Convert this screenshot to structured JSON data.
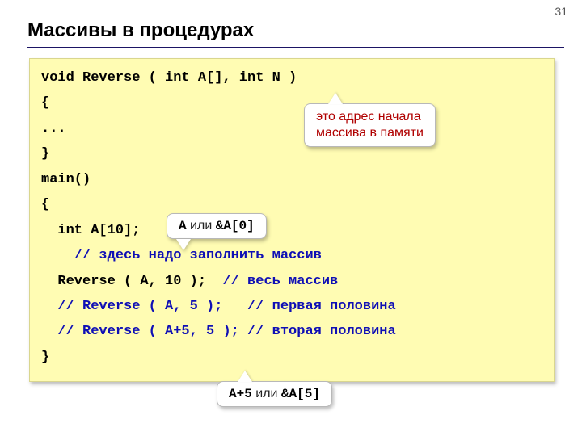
{
  "page_number": "31",
  "title": "Массивы в процедурах",
  "code": {
    "l1": "void Reverse ( int A[], int N )",
    "l2": "{",
    "l3": "...",
    "l4": "}",
    "l5": "main()",
    "l6": "{",
    "l7": "  int A[10];",
    "l8a": "    ",
    "l8b": "// здесь надо заполнить массив",
    "l9a": "  Reverse ( A, 10 );  ",
    "l9b": "// весь массив",
    "l10a": "  ",
    "l10b": "// Reverse ( A, 5 );   // первая половина",
    "l11a": "  ",
    "l11b": "// Reverse ( A+5, 5 ); // вторая половина",
    "l12": "}"
  },
  "callouts": {
    "top": {
      "line1": "это адрес начала",
      "line2": "массива в памяти"
    },
    "mid": {
      "m1": "A",
      "t1": " или ",
      "m2": "&A[0]"
    },
    "bot": {
      "m1": "A+5",
      "t1": " или ",
      "m2": "&A[5]"
    }
  }
}
